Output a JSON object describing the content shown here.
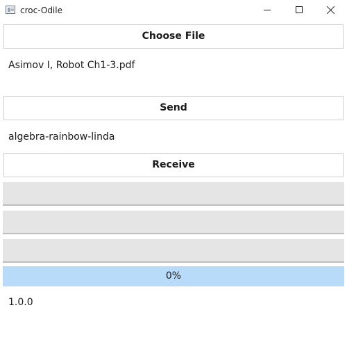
{
  "window": {
    "title": "croc-Odile"
  },
  "send": {
    "choose_file_label": "Choose File",
    "selected_file": "Asimov I, Robot Ch1-3.pdf",
    "send_label": "Send",
    "code_phrase": "algebra-rainbow-linda"
  },
  "receive": {
    "receive_label": "Receive",
    "field1_value": "",
    "field2_value": "",
    "field3_value": ""
  },
  "progress": {
    "value": 0,
    "text": "0%",
    "color": "#b9dbfa"
  },
  "footer": {
    "version": "1.0.0"
  }
}
